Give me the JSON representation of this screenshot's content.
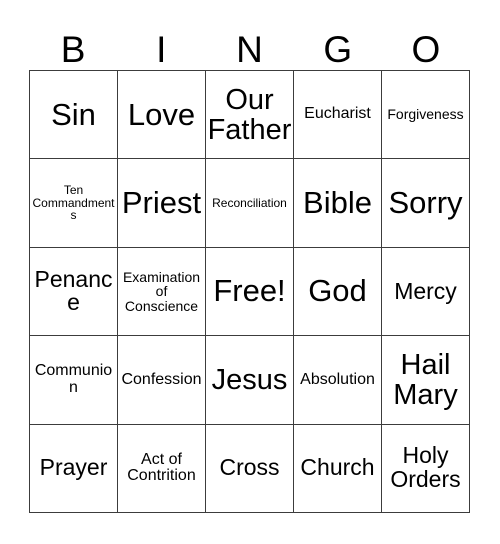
{
  "header": {
    "letters": [
      "B",
      "I",
      "N",
      "G",
      "O"
    ]
  },
  "grid": {
    "columns": 5,
    "rows": 5,
    "border_color": "#3c3c3c",
    "cell_background": "#ffffff",
    "text_color": "#000000",
    "cells": [
      {
        "text": "Sin",
        "size": "fs-xl"
      },
      {
        "text": "Love",
        "size": "fs-xl"
      },
      {
        "text": "Our Father",
        "size": "fs-lg"
      },
      {
        "text": "Eucharist",
        "size": "fs-sm"
      },
      {
        "text": "Forgiveness",
        "size": "fs-xs"
      },
      {
        "text": "Ten Commandments",
        "size": "fs-xxs"
      },
      {
        "text": "Priest",
        "size": "fs-xl"
      },
      {
        "text": "Reconciliation",
        "size": "fs-xxs"
      },
      {
        "text": "Bible",
        "size": "fs-xl"
      },
      {
        "text": "Sorry",
        "size": "fs-xl"
      },
      {
        "text": "Penance",
        "size": "fs-md"
      },
      {
        "text": "Examination of Conscience",
        "size": "fs-xs"
      },
      {
        "text": "Free!",
        "size": "fs-xl"
      },
      {
        "text": "God",
        "size": "fs-xl"
      },
      {
        "text": "Mercy",
        "size": "fs-md"
      },
      {
        "text": "Communion",
        "size": "fs-sm"
      },
      {
        "text": "Confession",
        "size": "fs-sm"
      },
      {
        "text": "Jesus",
        "size": "fs-lg"
      },
      {
        "text": "Absolution",
        "size": "fs-sm"
      },
      {
        "text": "Hail Mary",
        "size": "fs-lg"
      },
      {
        "text": "Prayer",
        "size": "fs-md"
      },
      {
        "text": "Act of Contrition",
        "size": "fs-sm"
      },
      {
        "text": "Cross",
        "size": "fs-md"
      },
      {
        "text": "Church",
        "size": "fs-md"
      },
      {
        "text": "Holy Orders",
        "size": "fs-md"
      }
    ]
  }
}
